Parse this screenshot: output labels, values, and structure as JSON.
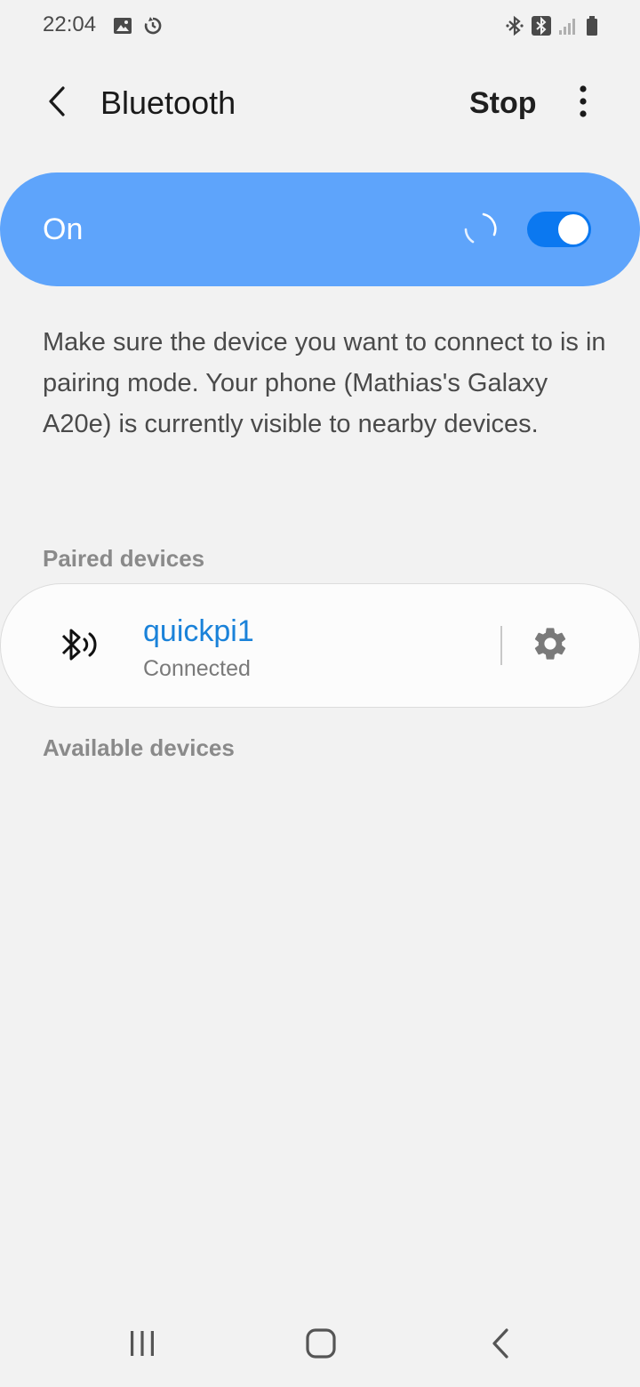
{
  "status_bar": {
    "time": "22:04",
    "left_icons": [
      "image-icon",
      "sync-icon"
    ],
    "right_icons": [
      "bluetooth-icon",
      "bluetooth-connected-icon",
      "signal-icon",
      "battery-icon"
    ]
  },
  "app_bar": {
    "title": "Bluetooth",
    "stop_label": "Stop",
    "back_icon": "back-chevron-icon",
    "more_icon": "more-vertical-icon"
  },
  "master_switch": {
    "label": "On",
    "state": true,
    "background_color": "#5ea4fb",
    "toggle_color": "#0b78f0"
  },
  "description": "Make sure the device you want to connect to is in pairing mode. Your phone (Mathias's Galaxy A20e) is currently visible to nearby devices.",
  "paired": {
    "header": "Paired devices",
    "devices": [
      {
        "name": "quickpi1",
        "status": "Connected",
        "icon": "bluetooth-audio-icon",
        "settings_icon": "gear-icon"
      }
    ]
  },
  "available": {
    "header": "Available devices"
  },
  "nav_bar": {
    "icons": [
      "recents-icon",
      "home-icon",
      "back-icon"
    ]
  },
  "colors": {
    "background": "#f2f2f2",
    "accent": "#1a82d9",
    "section_header": "#8a8a8a"
  }
}
